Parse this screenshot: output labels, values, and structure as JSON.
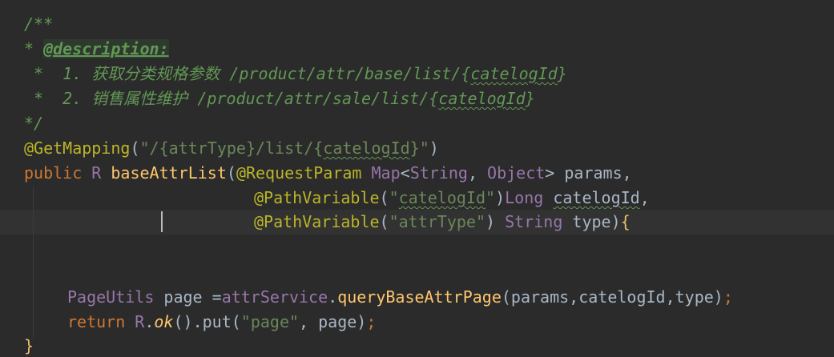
{
  "code": {
    "l1": "/**",
    "l2_star": "* ",
    "l2_tag": "@description:",
    "l3_prefix": " *  1. ",
    "l3_text": "获取分类规格参数 /product/attr/base/list/{",
    "l3_var": "catelogId",
    "l3_end": "}",
    "l4_prefix": " *  2. ",
    "l4_text": "销售属性维护 /product/attr/sale/list/{",
    "l4_var": "catelogId",
    "l4_end": "}",
    "l5": "*/",
    "l6_ann": "@GetMapping",
    "l6_open": "(",
    "l6_str1": "\"/{attrType}/list/{",
    "l6_var": "catelogId",
    "l6_str2": "}\"",
    "l6_close": ")",
    "l7_kw": "public ",
    "l7_type": "R ",
    "l7_fn": "baseAttrList",
    "l7_paren": "(",
    "l7_ann": "@RequestParam ",
    "l7_map": "Map",
    "l7_lt": "<",
    "l7_string": "String",
    "l7_comma": ", ",
    "l7_object": "Object",
    "l7_gt": "> ",
    "l7_param": "params,",
    "l8_ann": "@PathVariable",
    "l8_open": "(",
    "l8_q1": "\"",
    "l8_var": "catelogId",
    "l8_q2": "\"",
    "l8_close": ")",
    "l8_type": "Long ",
    "l8_param": "catelogId",
    "l8_comma": ",",
    "l9_ann": "@PathVariable",
    "l9_open": "(",
    "l9_str": "\"attrType\"",
    "l9_close": ") ",
    "l9_type": "String ",
    "l9_param": "type",
    "l9_close2": ")",
    "l9_brace": "{",
    "l12_type": "PageUtils ",
    "l12_var": "page ",
    "l12_eq": "=",
    "l12_field": "attrService",
    "l12_dot": ".",
    "l12_fn": "queryBaseAttrPage",
    "l12_args": "(params,catelogId,type)",
    "l12_semi": ";",
    "l13_kw": "return ",
    "l13_r": "R",
    "l13_dot": ".",
    "l13_ok": "ok",
    "l13_rest1": "().put(",
    "l13_str": "\"page\"",
    "l13_rest2": ", page)",
    "l13_semi": ";",
    "l14": "}"
  },
  "colors": {
    "background": "#2b2b2b",
    "doc_comment": "#629755",
    "annotation": "#bbb529",
    "keyword": "#cc7832",
    "type": "#9876aa",
    "string": "#6a8759",
    "method": "#ffc66d",
    "plain": "#a9b7c6"
  }
}
